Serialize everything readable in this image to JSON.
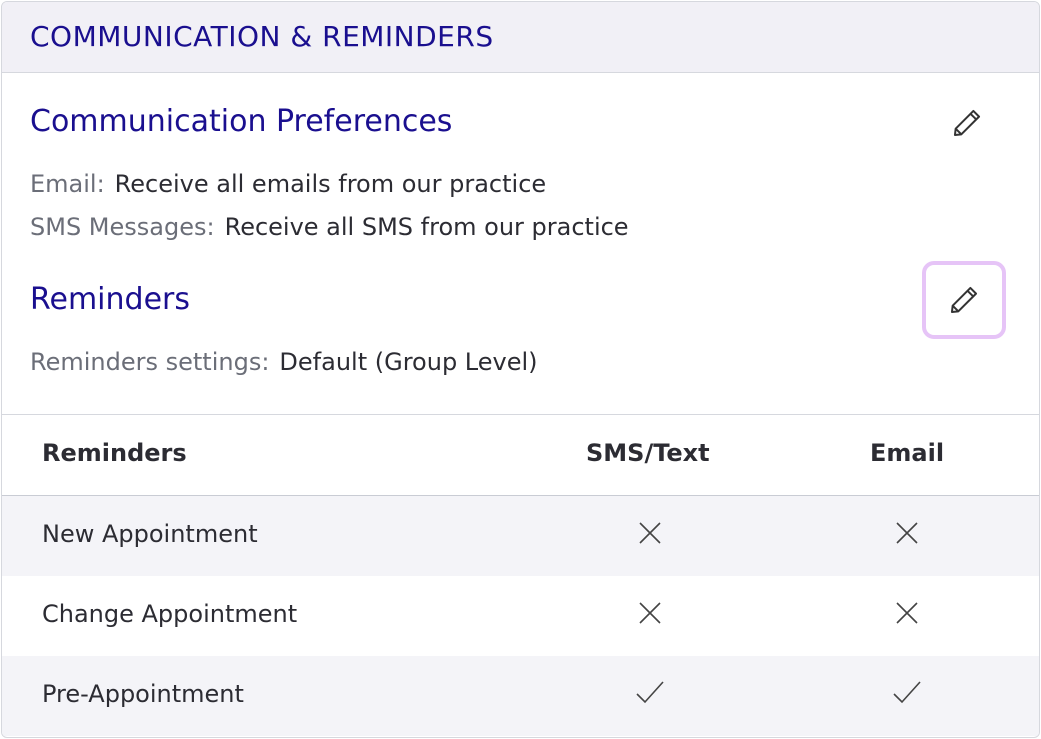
{
  "card": {
    "title": "COMMUNICATION & REMINDERS"
  },
  "communication": {
    "title": "Communication Preferences",
    "edit_icon": "pencil-icon",
    "email_label": "Email:",
    "email_value": "Receive all emails from our practice",
    "sms_label": "SMS Messages:",
    "sms_value": "Receive all SMS from our practice"
  },
  "reminders": {
    "title": "Reminders",
    "edit_icon": "pencil-icon",
    "settings_label": "Reminders settings:",
    "settings_value": "Default (Group Level)"
  },
  "table": {
    "headers": [
      "Reminders",
      "SMS/Text",
      "Email"
    ],
    "rows": [
      {
        "name": "New Appointment",
        "sms": "x-icon",
        "email": "x-icon"
      },
      {
        "name": "Change Appointment",
        "sms": "x-icon",
        "email": "x-icon"
      },
      {
        "name": "Pre-Appointment",
        "sms": "check-icon",
        "email": "check-icon"
      }
    ]
  },
  "colors": {
    "title": "#1a0f8f",
    "header_bg": "#f1f0f6",
    "focus_ring": "#e6c4f7",
    "alt_row": "#f4f4f8"
  }
}
